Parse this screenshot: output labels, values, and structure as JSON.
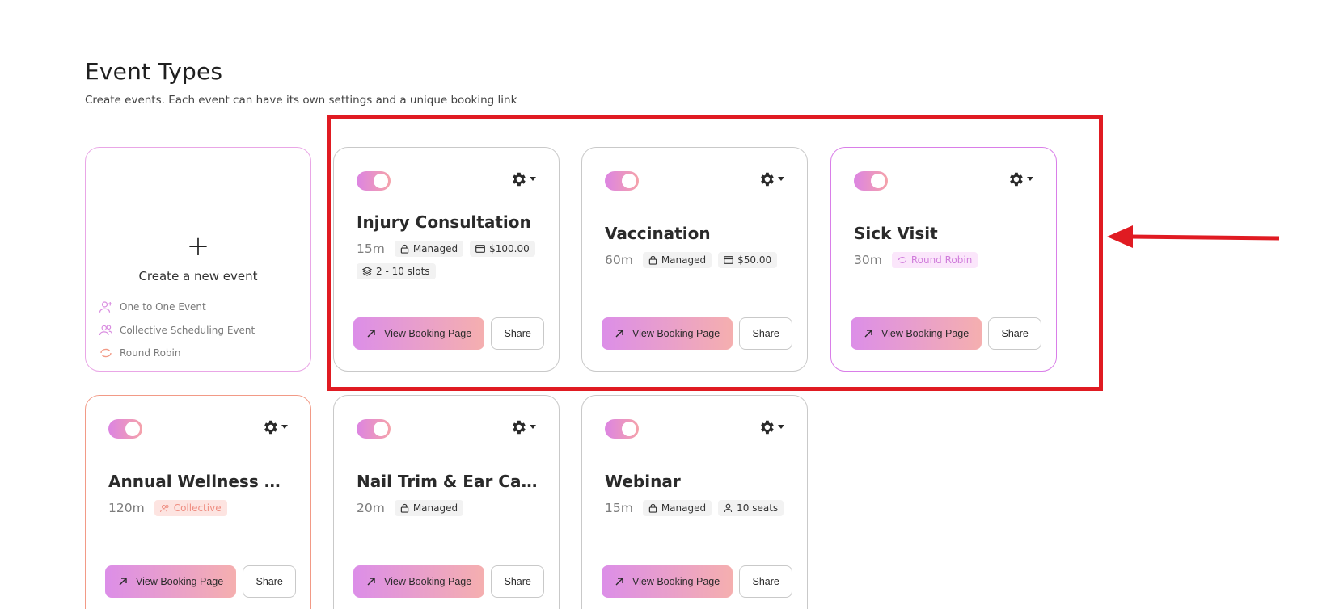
{
  "header": {
    "title": "Event Types",
    "subtitle": "Create events. Each event can have its own settings and a unique booking link"
  },
  "create_card": {
    "plus": "+",
    "label": "Create a new event",
    "options": [
      {
        "label": "One to One Event",
        "icon": "user-plus-icon"
      },
      {
        "label": "Collective Scheduling Event",
        "icon": "users-icon"
      },
      {
        "label": "Round Robin",
        "icon": "round-robin-icon"
      }
    ]
  },
  "cards": [
    {
      "title": "Injury Consultation",
      "duration": "15m",
      "badges": [
        "Managed",
        "$100.00",
        "2 - 10 slots"
      ],
      "enabled": true
    },
    {
      "title": "Vaccination",
      "duration": "60m",
      "badges": [
        "Managed",
        "$50.00"
      ],
      "enabled": true
    },
    {
      "title": "Sick Visit",
      "duration": "30m",
      "badges": [
        "Round Robin"
      ],
      "enabled": true
    },
    {
      "title": "Annual Wellness Exam",
      "duration": "120m",
      "badges": [
        "Collective"
      ],
      "enabled": true
    },
    {
      "title": "Nail Trim & Ear Care (...",
      "duration": "20m",
      "badges": [
        "Managed"
      ],
      "enabled": true
    },
    {
      "title": "Webinar",
      "duration": "15m",
      "badges": [
        "Managed",
        "10 seats"
      ],
      "enabled": true
    }
  ],
  "buttons": {
    "view_booking": "View Booking Page",
    "share": "Share"
  },
  "colors": {
    "brand_gradient_start": "#dc84e2",
    "brand_gradient_end": "#f5a2aa",
    "annotation_red": "#e01b22"
  }
}
